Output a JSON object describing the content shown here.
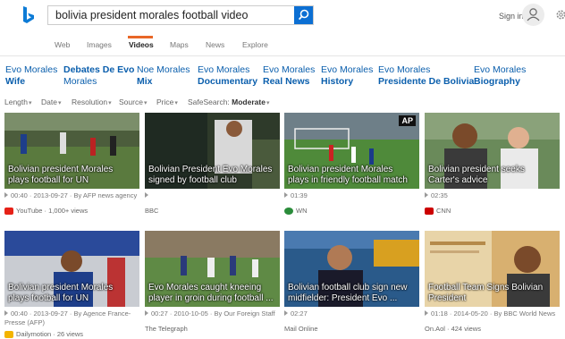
{
  "header": {
    "query": "bolivia president morales football video",
    "signin_label": "Sign in"
  },
  "tabs": [
    "Web",
    "Images",
    "Videos",
    "Maps",
    "News",
    "Explore"
  ],
  "related": [
    {
      "line1": "Evo Morales",
      "line2": "Wife"
    },
    {
      "line1": "Debates De Evo",
      "line2": "Morales"
    },
    {
      "line1": "Noe Morales",
      "line2": "Mix"
    },
    {
      "line1": "Evo Morales",
      "line2": "Documentary"
    },
    {
      "line1": "Evo Morales",
      "line2": "Real News"
    },
    {
      "line1": "Evo Morales",
      "line2": "History"
    },
    {
      "line1": "Evo Morales",
      "line2": "Presidente De Bolivia"
    },
    {
      "line1": "Evo Morales",
      "line2": "Biography"
    }
  ],
  "filters": {
    "length": "Length",
    "date": "Date",
    "resolution": "Resolution",
    "source": "Source",
    "price": "Price",
    "safesearch_label": "SafeSearch:",
    "safesearch_value": "Moderate"
  },
  "videos": [
    {
      "title": "Bolivian president Morales plays football for UN",
      "duration": "00:40",
      "meta": "· 2013-09-27 · By AFP news agency",
      "meta2": "",
      "source": "YouTube · 1,000+ views",
      "source_color": "#e62117"
    },
    {
      "title": "Bolivian President Evo Morales signed by football club",
      "duration": "",
      "meta": "",
      "meta2": "",
      "source": "BBC",
      "source_color": ""
    },
    {
      "title": "Bolivian president Morales plays in friendly football match",
      "duration": "01:39",
      "meta": "",
      "meta2": "",
      "source": "WN",
      "source_color": "#2a8c3a",
      "badge": "AP"
    },
    {
      "title": "Bolivian president seeks Carter's advice",
      "duration": "02:35",
      "meta": "",
      "meta2": "",
      "source": "CNN",
      "source_color": "#cc0000"
    },
    {
      "title": "Bolivian president Morales plays football for UN",
      "duration": "00:40",
      "meta": "· 2013-09-27 · By Agence France-",
      "meta2": "Presse (AFP)",
      "source": "Dailymotion · 26 views",
      "source_color": "#f3b400"
    },
    {
      "title": "Evo Morales caught kneeing player in groin during football ...",
      "duration": "00:27",
      "meta": "· 2010-10-05 · By Our Foreign Staff",
      "meta2": "",
      "source": "The Telegraph",
      "source_color": ""
    },
    {
      "title": "Bolivian football club sign new midfielder: President Evo ...",
      "duration": "02:27",
      "meta": "",
      "meta2": "",
      "source": "Mail Online",
      "source_color": ""
    },
    {
      "title": "Football Team Signs Bolivian President",
      "duration": "01:18",
      "meta": "· 2014-05-20 · By BBC World News",
      "meta2": "",
      "source": "On.Aol · 424 views",
      "source_color": ""
    }
  ]
}
